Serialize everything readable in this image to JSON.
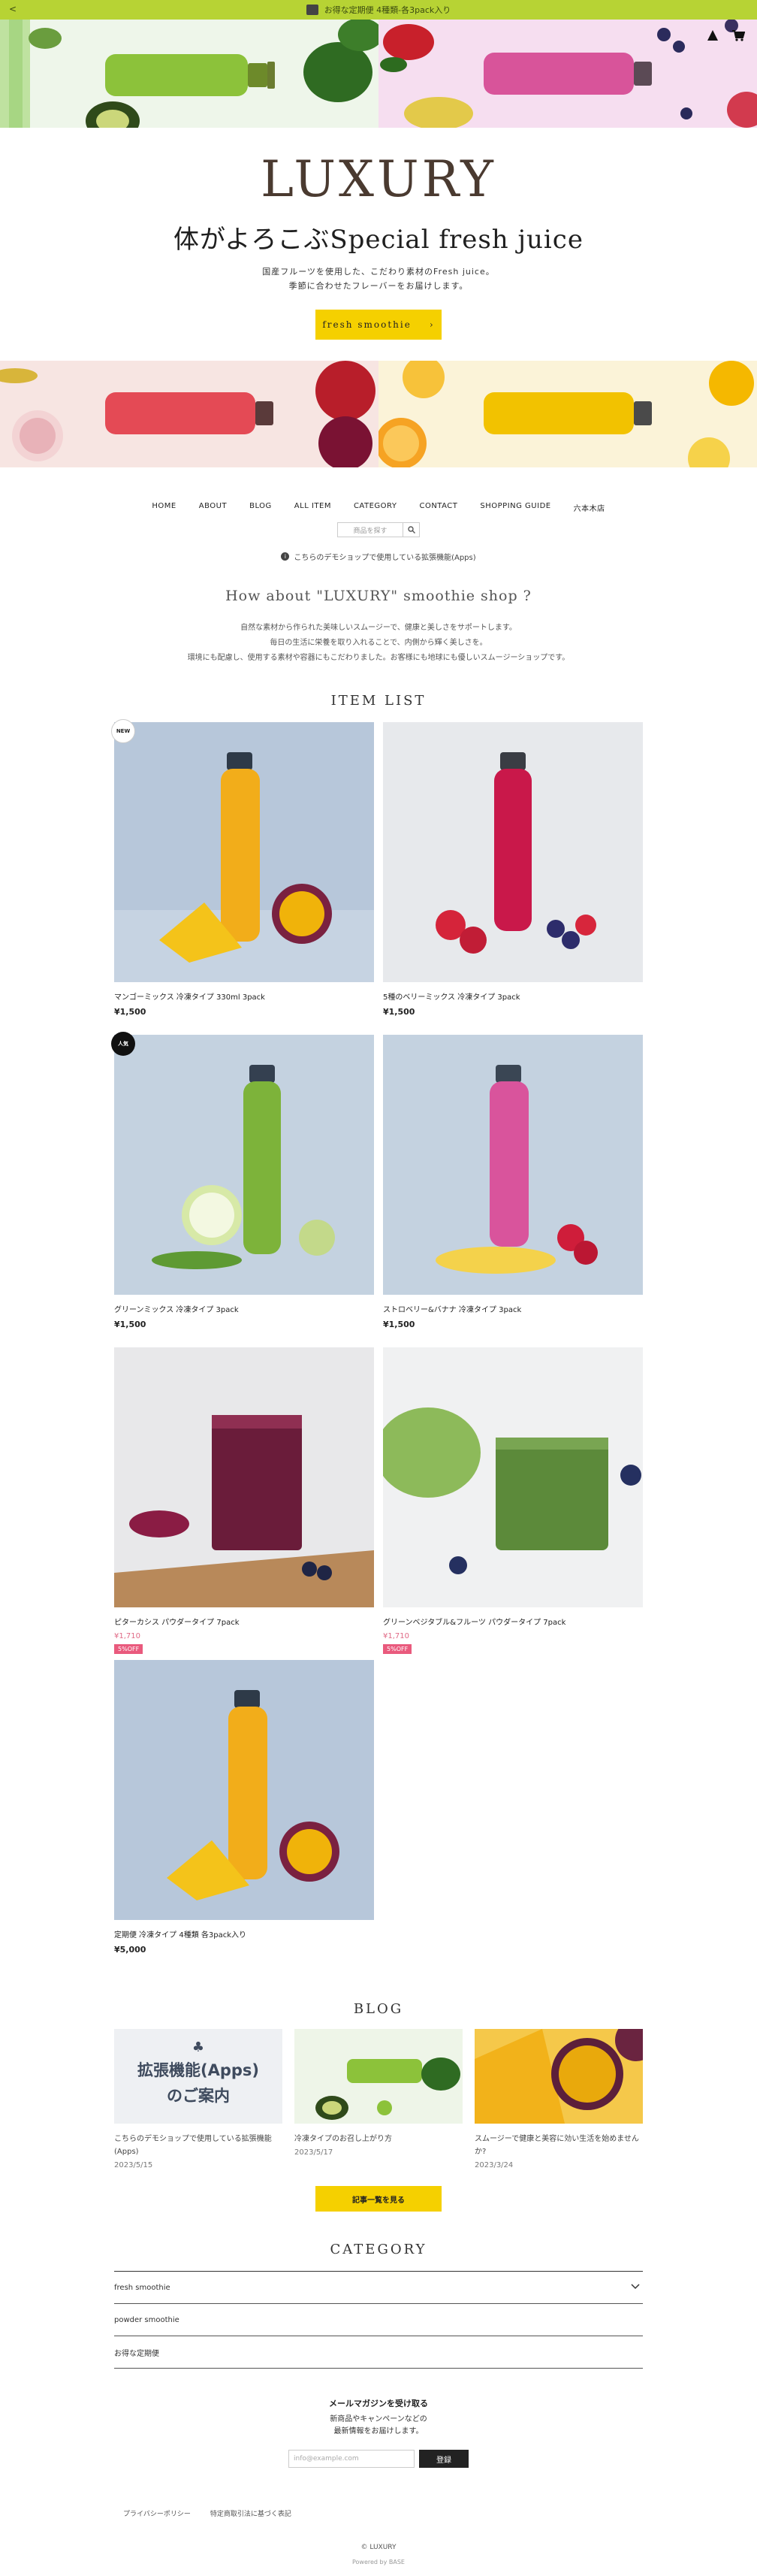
{
  "topbar": {
    "chevron": "<",
    "text": "お得な定期便 4種類-各3pack入り"
  },
  "header": {
    "lock_icon": "lock-icon",
    "cart_icon": "cart-icon"
  },
  "brand": {
    "logo": "LUXURY",
    "tagline": "体がよろこぶSpecial fresh juice",
    "desc_line1": "国産フルーツを使用した、こだわり素材のFresh juice。",
    "desc_line2": "季節に合わせたフレーバーをお届けします。",
    "cta_label": "fresh smoothie",
    "cta_arrow": "›"
  },
  "nav": {
    "items": [
      "HOME",
      "ABOUT",
      "BLOG",
      "ALL ITEM",
      "CATEGORY",
      "CONTACT",
      "SHOPPING GUIDE",
      "六本木店"
    ]
  },
  "search": {
    "placeholder": "商品を探す",
    "button_icon": "search-icon"
  },
  "notice": {
    "icon": "info-icon",
    "text": "こちらのデモショップで使用している拡張機能(Apps)"
  },
  "about": {
    "title": "How about \"LUXURY\" smoothie shop ?",
    "line1": "自然な素材から作られた美味しいスムージーで、健康と美しさをサポートします。",
    "line2": "毎日の生活に栄養を取り入れることで、内側から輝く美しさを。",
    "line3": "環境にも配慮し、使用する素材や容器にもこだわりました。お客様にも地球にも優しいスムージーショップです。"
  },
  "item_list": {
    "title": "ITEM LIST",
    "items": [
      {
        "name": "マンゴーミックス 冷凍タイプ 330ml 3pack",
        "price": "¥1,500",
        "badge": "NEW",
        "off": ""
      },
      {
        "name": "5種のベリーミックス 冷凍タイプ 3pack",
        "price": "¥1,500",
        "badge": "",
        "off": ""
      },
      {
        "name": "グリーンミックス 冷凍タイプ 3pack",
        "price": "¥1,500",
        "badge": "人気",
        "off": ""
      },
      {
        "name": "ストロベリー&バナナ 冷凍タイプ 3pack",
        "price": "¥1,500",
        "badge": "",
        "off": ""
      },
      {
        "name": "ピターカシス パウダータイプ 7pack",
        "price": "¥1,710",
        "badge": "",
        "off": "5%OFF"
      },
      {
        "name": "グリーンベジタブル&フルーツ パウダータイプ 7pack",
        "price": "¥1,710",
        "badge": "",
        "off": "5%OFF"
      },
      {
        "name": "定期便 冷凍タイプ 4種類 各3pack入り",
        "price": "¥5,000",
        "badge": "",
        "off": ""
      }
    ]
  },
  "blog": {
    "title": "BLOG",
    "posts": [
      {
        "thumb_title_line1": "拡張機能(Apps)",
        "thumb_title_line2": "のご案内",
        "title": "こちらのデモショップで使用している拡張機能(Apps)",
        "date": "2023/5/15"
      },
      {
        "title": "冷凍タイプのお召し上がり方",
        "date": "2023/5/17"
      },
      {
        "title": "スムージーで健康と美容に効い生活を始めませんか?",
        "date": "2023/3/24"
      }
    ],
    "more_label": "記事一覧を見る"
  },
  "category": {
    "title": "CATEGORY",
    "items": [
      "fresh smoothie",
      "powder smoothie",
      "お得な定期便"
    ],
    "expand_icon": "chevron-down-icon"
  },
  "mail": {
    "title": "メールマガジンを受け取る",
    "line1": "新商品やキャンペーンなどの",
    "line2": "最新情報をお届けします。",
    "placeholder": "info@example.com",
    "submit": "登録"
  },
  "footer": {
    "links": [
      "プライバシーポリシー",
      "特定商取引法に基づく表記"
    ],
    "copyright": "© LUXURY",
    "powered": "Powered by BASE"
  },
  "colors": {
    "accent_yellow": "#f5d000",
    "topbar_green": "#b7d334",
    "sale_pink": "#e95a7d",
    "logo_brown": "#4a3a30"
  }
}
